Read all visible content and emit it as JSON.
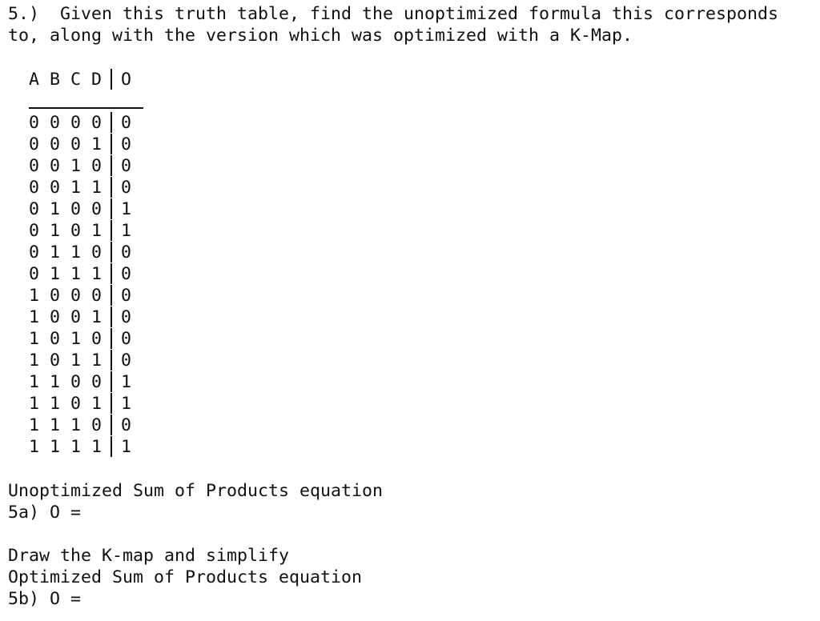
{
  "question": {
    "line1": "5.)  Given this truth table, find the unoptimized formula this corresponds",
    "line2": "to, along with the version which was optimized with a K-Map."
  },
  "truth_table": {
    "inputs_header": "A B C D",
    "output_header": "O",
    "rows": [
      {
        "inputs": "0 0 0 0",
        "output": "0"
      },
      {
        "inputs": "0 0 0 1",
        "output": "0"
      },
      {
        "inputs": "0 0 1 0",
        "output": "0"
      },
      {
        "inputs": "0 0 1 1",
        "output": "0"
      },
      {
        "inputs": "0 1 0 0",
        "output": "1"
      },
      {
        "inputs": "0 1 0 1",
        "output": "1"
      },
      {
        "inputs": "0 1 1 0",
        "output": "0"
      },
      {
        "inputs": "0 1 1 1",
        "output": "0"
      },
      {
        "inputs": "1 0 0 0",
        "output": "0"
      },
      {
        "inputs": "1 0 0 1",
        "output": "0"
      },
      {
        "inputs": "1 0 1 0",
        "output": "0"
      },
      {
        "inputs": "1 0 1 1",
        "output": "0"
      },
      {
        "inputs": "1 1 0 0",
        "output": "1"
      },
      {
        "inputs": "1 1 0 1",
        "output": "1"
      },
      {
        "inputs": "1 1 1 0",
        "output": "0"
      },
      {
        "inputs": "1 1 1 1",
        "output": "1"
      }
    ]
  },
  "part_a": {
    "heading": "Unoptimized Sum of Products equation",
    "prompt": "5a) O ="
  },
  "part_b": {
    "instruction": "Draw the K-map and simplify",
    "heading": "Optimized Sum of Products equation",
    "prompt": "5b) O ="
  }
}
